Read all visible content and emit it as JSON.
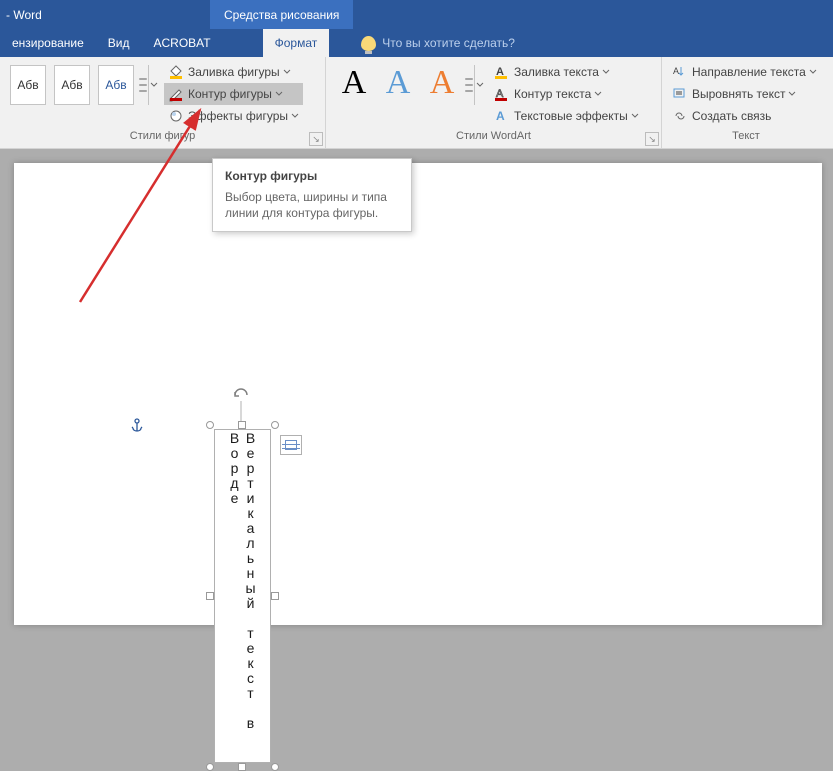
{
  "title": "- Word",
  "drawing_tools": "Средства рисования",
  "tabs": {
    "review": "ензирование",
    "view": "Вид",
    "acrobat": "ACROBAT",
    "format": "Формат",
    "tellme": "Что вы хотите сделать?"
  },
  "shape_styles": {
    "sample": "Абв",
    "label": "Стили фигур",
    "fill": "Заливка фигуры",
    "outline": "Контур фигуры",
    "effects": "Эффекты фигуры"
  },
  "wordart": {
    "label": "Стили WordArt",
    "text_fill": "Заливка текста",
    "text_outline": "Контур текста",
    "text_effects": "Текстовые эффекты"
  },
  "text_group": {
    "label": "Текст",
    "direction": "Направление текста",
    "align": "Выровнять текст",
    "link": "Создать связь"
  },
  "tooltip": {
    "title": "Контур фигуры",
    "body": "Выбор цвета, ширины и типа линии для контура фигуры."
  },
  "doc": {
    "text": "Вертикальный текст в Ворде"
  }
}
